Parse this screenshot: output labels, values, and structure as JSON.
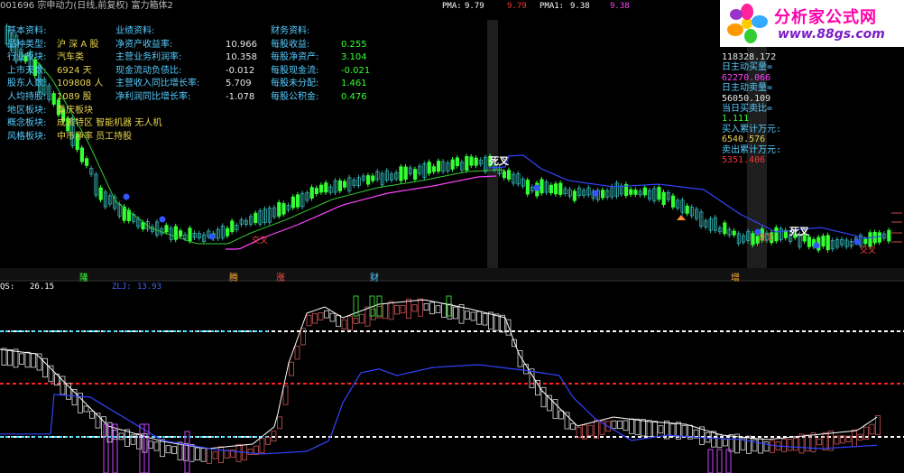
{
  "header": {
    "title": "001696 宗申动力(日线,前复权) 富力箱体2",
    "ma_items": [
      {
        "label": "PMA:",
        "value": "9.79",
        "color": "#ffffff"
      },
      {
        "label": "",
        "value": "9.79",
        "color": "#ff3333"
      },
      {
        "label": "PMA1:",
        "value": "9.38",
        "color": "#ffffff"
      },
      {
        "label": "",
        "value": "9.38",
        "color": "#ff44ff"
      }
    ]
  },
  "logo": {
    "name": "分析家公式网",
    "url_text": "www.88gs.com"
  },
  "info": {
    "basic_heading": "基本资料:",
    "basic": [
      {
        "label": "品种类型:",
        "value": "沪 深 A 股"
      },
      {
        "label": "行业板块:",
        "value": "汽车类"
      },
      {
        "label": "上市天数:",
        "value": "6924 天"
      },
      {
        "label": "股东人数:",
        "value": "109808 人"
      },
      {
        "label": "人均持股:",
        "value": "1089 股"
      },
      {
        "label": "地区板块:",
        "value": "重庆板块"
      },
      {
        "label": "概念板块:",
        "value": "成渝特区 智能机器 无人机"
      },
      {
        "label": "风格板块:",
        "value": "中市净率 员工持股"
      }
    ],
    "perf_heading": "业绩资料:",
    "perf": [
      {
        "label": "净资产收益率:",
        "value": "10.966"
      },
      {
        "label": "主营业务利润率:",
        "value": "10.358"
      },
      {
        "label": "现金流动负债比:",
        "value": "-0.012"
      },
      {
        "label": "主营收入同比增长率:",
        "value": "5.709"
      },
      {
        "label": "净利润同比增长率:",
        "value": "-1.078"
      }
    ],
    "fin_heading": "财务资料:",
    "fin": [
      {
        "label": "每股收益:",
        "value": "0.255"
      },
      {
        "label": "每股净资产:",
        "value": "3.104"
      },
      {
        "label": "每股现金流:",
        "value": "-0.021"
      },
      {
        "label": "每股未分配:",
        "value": "1.461"
      },
      {
        "label": "每股公积金:",
        "value": "0.476"
      }
    ]
  },
  "right_panel": [
    {
      "text": "118328.172",
      "color": "#e8e8e8"
    },
    {
      "text": "日主动买量=",
      "color": "#55ccff"
    },
    {
      "text": "62270.066",
      "color": "#ff44ff"
    },
    {
      "text": "日主动卖量=",
      "color": "#55ccff"
    },
    {
      "text": "56050.109",
      "color": "#e8e8e8"
    },
    {
      "text": "当日买卖比=",
      "color": "#55ccff"
    },
    {
      "text": "1.111",
      "color": "#33ff33"
    },
    {
      "text": "买入累计万元:",
      "color": "#55ccff"
    },
    {
      "text": "6540.576",
      "color": "#e8d44d"
    },
    {
      "text": "卖出累计万元:",
      "color": "#55ccff"
    },
    {
      "text": "5351.406",
      "color": "#ff3333"
    }
  ],
  "signals": {
    "death_cross": "死叉",
    "cross_mark": "交叉"
  },
  "markers": [
    {
      "text": "隆",
      "color": "#33ff33"
    },
    {
      "text": "腾",
      "color": "#ffaa33"
    },
    {
      "text": "涨",
      "color": "#ff5555"
    },
    {
      "text": "财",
      "color": "#55ccff"
    },
    {
      "text": "增",
      "color": "#ffaa33"
    }
  ],
  "oscillator": {
    "qs_label": "QS:",
    "qs_value": "26.15",
    "zl_label": "ZLJ:",
    "zl_value": "13.93"
  },
  "colors": {
    "bull_candle": "#33ff33",
    "bear_candle": "#33aaaa",
    "ma_main": "#ff44ff",
    "ma_long": "#3344ff",
    "osc_white_line": "#ffffff",
    "osc_blue_line": "#3344ff",
    "level_white": "#ffffff",
    "level_red": "#ff2222",
    "level_cyan": "#44ddff"
  }
}
